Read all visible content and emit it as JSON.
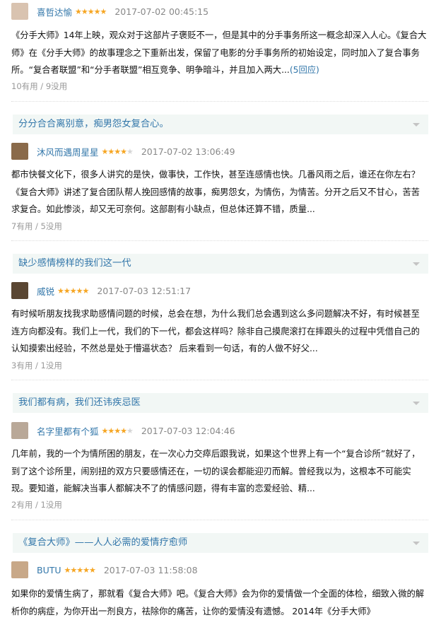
{
  "reviews": [
    {
      "title": "",
      "user": "喜哲达愉",
      "rating": 5,
      "time": "2017-07-02 00:45:15",
      "text": "《分手大师》14年上映，观众对于这部片子褒贬不一，但是其中的分手事务所这一概念却深入人心。《复合大师》在《分手大师》的故事理念之下重新出发，保留了电影的分手事务所的初始设定，同时加入了复合事务所。“复合者联盟”和“分手者联盟”相互竞争、明争暗斗，并且加入两大...",
      "replies": "(5回应)",
      "votes": "10有用 / 9没用",
      "avatar_color": "#d9c3b0"
    },
    {
      "title": "分分合合离别意，痴男怨女复合心。",
      "user": "沐风而遇周星星",
      "rating": 4,
      "time": "2017-07-02 13:06:49",
      "text": "都市快餐文化下，很多人讲究的是快，做事快，工作快，甚至连感情也快。几番风雨之后，谁还在你左右？《复合大师》讲述了复合团队帮人挽回感情的故事，痴男怨女，为情伤，为情苦。分开之后又不甘心，苦苦求复合。如此惨淡，却又无可奈何。这部剧有小缺点，但总体还算不错，质量...",
      "replies": "",
      "votes": "7有用 / 5没用",
      "avatar_color": "#8a6a4a"
    },
    {
      "title": "缺少感情榜样的我们这一代",
      "user": "威锐",
      "rating": 5,
      "time": "2017-07-03 12:51:17",
      "text": "有时候听朋友找我求助感情问题的时候，总会在想，为什么我们总会遇到这么多问题解决不好，有时候甚至连方向都没有。我们上一代，我们的下一代，都会这样吗？除非自己摸爬滚打在摔跟头的过程中凭借自己的认知摸索出经验，不然总是处于懵逼状态？ 后来看到一句话，有的人做不好父...",
      "replies": "",
      "votes": "3有用 / 1没用",
      "avatar_color": "#5a4632"
    },
    {
      "title": "我们都有病，我们还讳疾忌医",
      "user": "名字里都有个狐",
      "rating": 4,
      "time": "2017-07-03 12:04:46",
      "text": "几年前，我的一个为情所困的朋友，在一次心力交瘁后跟我说，如果这个世界上有一个“复合诊所”就好了，到了这个诊所里，闹别扭的双方只要感情还在，一切的误会都能迎刃而解。曾经我以为，这根本不可能实现。要知道，能解决当事人都解决不了的情感问题，得有丰富的恋爱经验、精...",
      "replies": "",
      "votes": "2有用 / 1没用",
      "avatar_color": "#b9a898"
    },
    {
      "title": "《复合大师》——人人必需的爱情疗愈师",
      "user": "BUTU",
      "rating": 5,
      "time": "2017-07-03 11:58:08",
      "text": "如果你的爱情生病了，那就看《复合大师》吧。《复合大师》会为你的爱情做一个全面的体检，细致入微的解析你的病症，为你开出一剂良方，祛除你的痛苦，让你的爱情没有遗憾。 2014年《分手大师》",
      "replies": "",
      "votes": "",
      "avatar_color": "#c8a888"
    }
  ]
}
